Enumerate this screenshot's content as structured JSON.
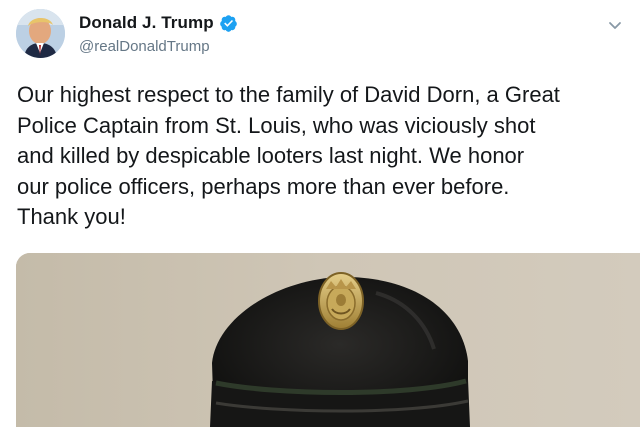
{
  "tweet": {
    "author_name": "Donald J. Trump",
    "author_handle": "@realDonaldTrump",
    "verified": true,
    "text_lines": [
      "Our highest respect to the family of David Dorn, a Great",
      "Police Captain from St. Louis, who was viciously shot",
      "and killed by despicable looters last night. We honor",
      "our police officers, perhaps more than ever before.",
      "Thank you!"
    ]
  },
  "icons": {
    "verified": "verified-badge-icon",
    "more": "chevron-down-icon"
  },
  "colors": {
    "verified_blue": "#1da1f2",
    "text": "#14171a",
    "muted": "#657786"
  }
}
